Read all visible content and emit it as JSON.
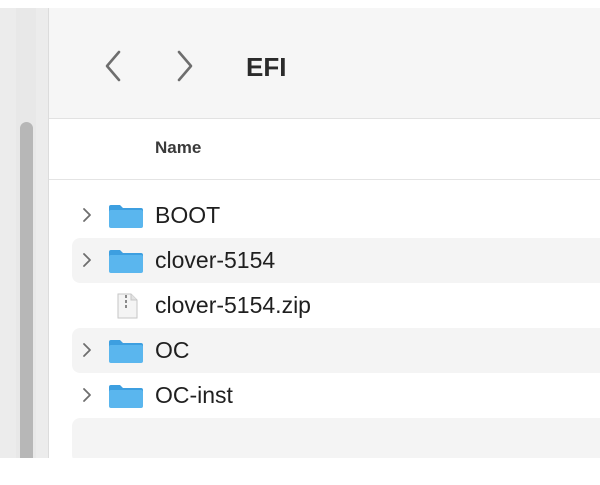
{
  "window": {
    "title": "EFI"
  },
  "toolbar": {
    "back_icon": "chevron-left-icon",
    "forward_icon": "chevron-right-icon",
    "title": "EFI"
  },
  "columns": {
    "name": "Name"
  },
  "items": [
    {
      "label": "BOOT",
      "kind": "folder",
      "expandable": true
    },
    {
      "label": "clover-5154",
      "kind": "folder",
      "expandable": true
    },
    {
      "label": "clover-5154.zip",
      "kind": "zip-file",
      "expandable": false
    },
    {
      "label": "OC",
      "kind": "folder",
      "expandable": true
    },
    {
      "label": "OC-inst",
      "kind": "folder",
      "expandable": true
    }
  ],
  "colors": {
    "folder": "#5ab6ee",
    "folder_tab": "#3d9fe0",
    "toolbar_bg": "#f6f6f6",
    "row_alt": "#f4f4f4",
    "chevron": "#6e6e6e"
  }
}
